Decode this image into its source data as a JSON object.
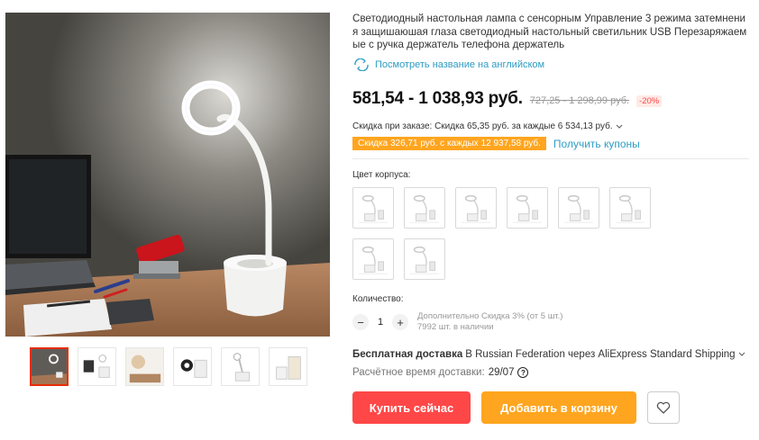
{
  "product": {
    "title": "Светодиодный настольная лампа с сенсорным Управление 3 режима затемнения защишаюшая глаза светодиодный настольный светильник USB Перезаряжаемые с ручка держатель телефона держатель",
    "translate_link": "Посмотреть название на английском",
    "icons": {
      "translate": "translate-icon",
      "help": "help-icon",
      "wishlist": "heart-icon"
    }
  },
  "price": {
    "range": "581,54 - 1 038,93 руб.",
    "original": "727,25 - 1 298,99 руб.",
    "discount": "-20%"
  },
  "promotions": {
    "order_discount": "Скидка при заказе: Скидка 65,35 руб. за каждые 6 534,13 руб.",
    "coupon": "Скидка 326,71 руб. с каждых 12 937,58 руб.",
    "get_coupons": "Получить купоны"
  },
  "variants": {
    "label": "Цвет корпуса:",
    "count": 8
  },
  "quantity": {
    "label": "Количество:",
    "minus": "−",
    "value": "1",
    "plus": "+",
    "bulk_discount": "Дополнительно Скидка 3% (от 5 шт.)",
    "stock": "7992 шт. в наличии"
  },
  "shipping": {
    "free_label": "Бесплатная доставка",
    "details": "В Russian Federation через AliExpress Standard Shipping",
    "eta_label": "Расчётное время доставки:",
    "eta_date": "29/07"
  },
  "actions": {
    "buy_now": "Купить сейчас",
    "add_to_cart": "Добавить в корзину"
  },
  "colors": {
    "accent_red": "#ff4747",
    "accent_orange": "#ffa51f",
    "link_blue": "#2e9cc3"
  }
}
